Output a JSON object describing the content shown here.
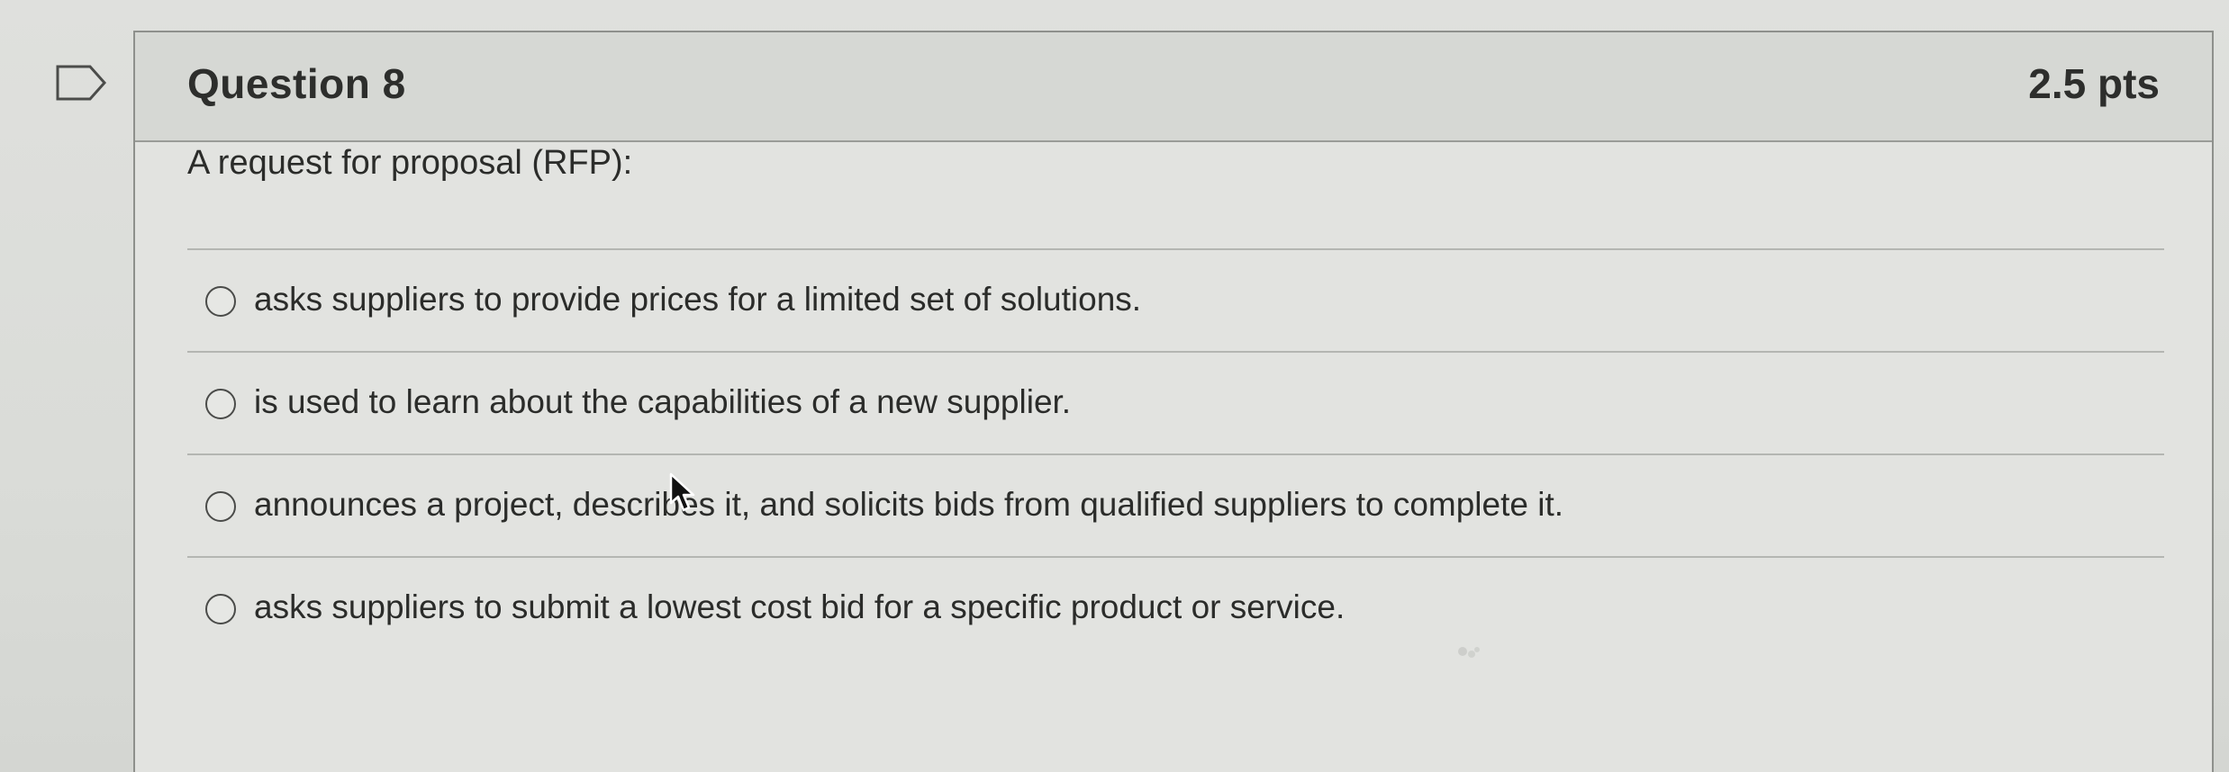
{
  "question": {
    "title": "Question 8",
    "points": "2.5 pts",
    "prompt": "A request for proposal (RFP):",
    "answers": [
      {
        "label": "asks suppliers to provide prices for a limited set of solutions.",
        "selected": false
      },
      {
        "label": "is used to learn about the capabilities of a new supplier.",
        "selected": false
      },
      {
        "label": "announces a project, describes it, and solicits bids from qualified suppliers to complete it.",
        "selected": false
      },
      {
        "label": "asks suppliers to submit a lowest cost bid for a specific product or service.",
        "selected": false
      }
    ]
  },
  "icons": {
    "flag": "flag-outline-icon",
    "cursor": "mouse-pointer-icon"
  },
  "colors": {
    "background": "#dcdedb",
    "header": "#d6d8d4",
    "text": "#2d2e2c",
    "border": "#8e908c"
  }
}
